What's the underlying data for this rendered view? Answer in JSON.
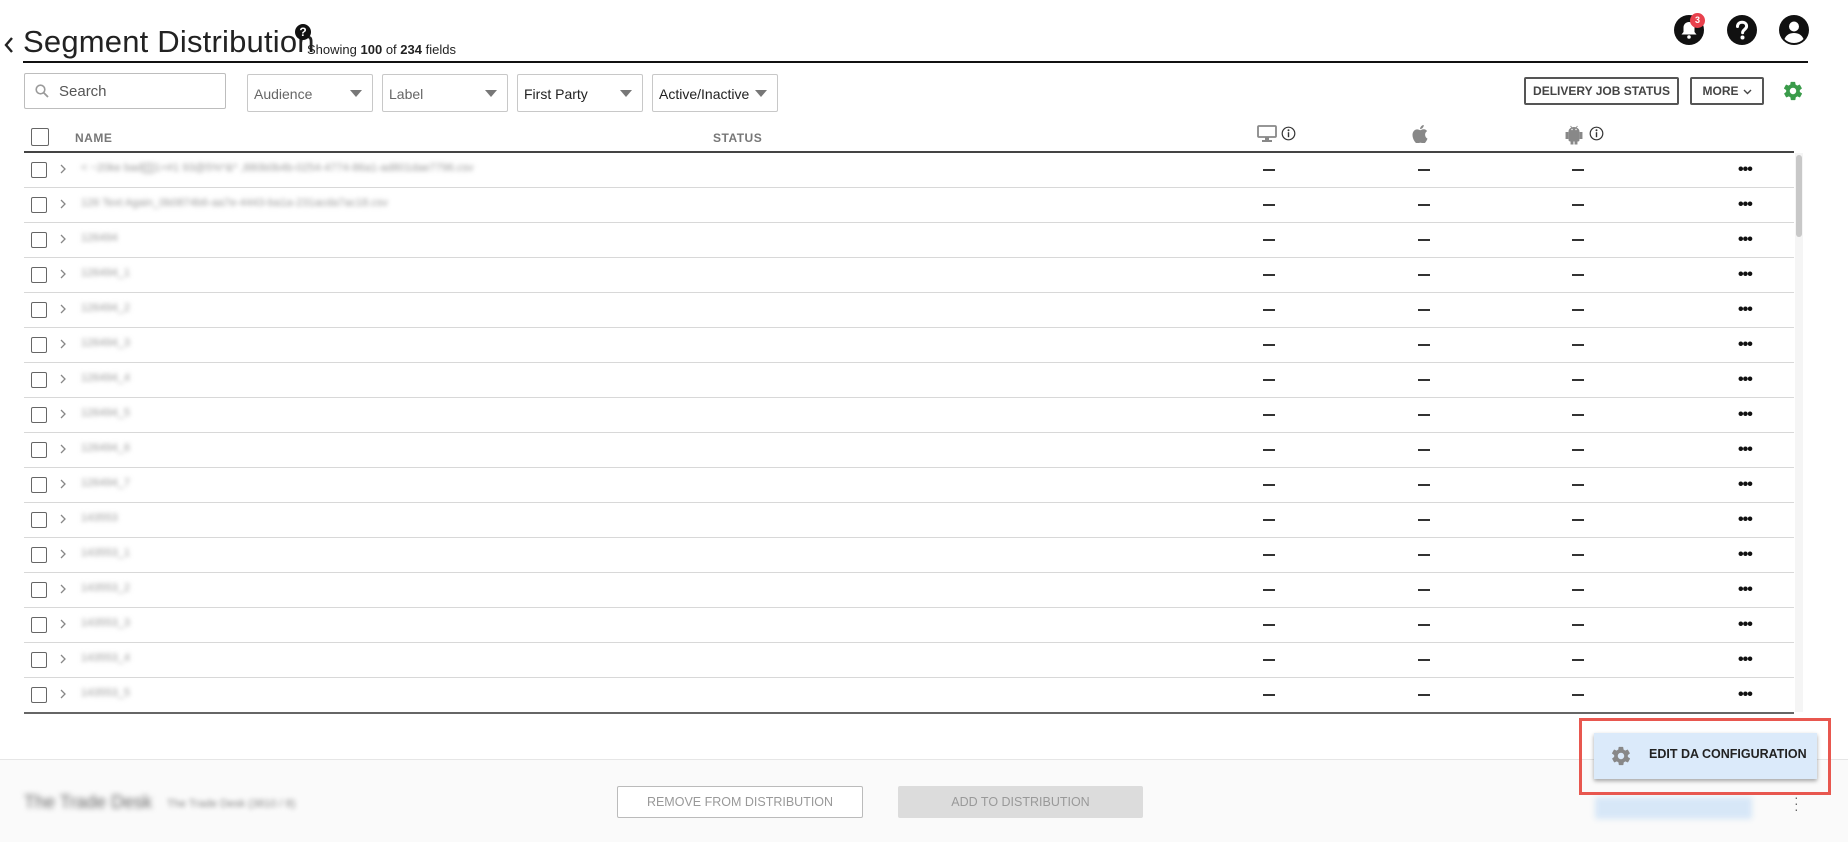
{
  "header": {
    "title": "Segment Distribution",
    "showing_prefix": "Showing",
    "shown_count": "100",
    "of_word": "of",
    "total_count": "234",
    "fields_word": "fields",
    "notification_count": "3"
  },
  "toolbar": {
    "search_placeholder": "Search",
    "filters": {
      "audience": "Audience",
      "label": "Label",
      "first_party": "First Party",
      "active_inactive": "Active/Inactive"
    },
    "delivery_button": "DELIVERY JOB STATUS",
    "more_button": "MORE"
  },
  "table": {
    "columns": {
      "name": "NAME",
      "status": "STATUS"
    },
    "platform_columns": [
      "desktop-icon",
      "apple-icon",
      "android-icon"
    ],
    "rows": [
      {
        "name": "< ~20ke bad[[]]1+#1 93@5%*&* ,880b0b4b-0254-4774-86a1-ad801dae7796.csv",
        "desktop": "—",
        "apple": "—",
        "android": "—"
      },
      {
        "name": "126 Text Again_0b0874b6-aa7e-4443-ba1a-231acda7ac18.csv",
        "desktop": "—",
        "apple": "—",
        "android": "—"
      },
      {
        "name": "126494",
        "desktop": "—",
        "apple": "—",
        "android": "—"
      },
      {
        "name": "126494_1",
        "desktop": "—",
        "apple": "—",
        "android": "—"
      },
      {
        "name": "126494_2",
        "desktop": "—",
        "apple": "—",
        "android": "—"
      },
      {
        "name": "126494_3",
        "desktop": "—",
        "apple": "—",
        "android": "—"
      },
      {
        "name": "126494_4",
        "desktop": "—",
        "apple": "—",
        "android": "—"
      },
      {
        "name": "126494_5",
        "desktop": "—",
        "apple": "—",
        "android": "—"
      },
      {
        "name": "126494_6",
        "desktop": "—",
        "apple": "—",
        "android": "—"
      },
      {
        "name": "126494_7",
        "desktop": "—",
        "apple": "—",
        "android": "—"
      },
      {
        "name": "143553",
        "desktop": "—",
        "apple": "—",
        "android": "—"
      },
      {
        "name": "143553_1",
        "desktop": "—",
        "apple": "—",
        "android": "—"
      },
      {
        "name": "143553_2",
        "desktop": "—",
        "apple": "—",
        "android": "—"
      },
      {
        "name": "143553_3",
        "desktop": "—",
        "apple": "—",
        "android": "—"
      },
      {
        "name": "143553_4",
        "desktop": "—",
        "apple": "—",
        "android": "—"
      },
      {
        "name": "143553_5",
        "desktop": "—",
        "apple": "—",
        "android": "—"
      }
    ]
  },
  "footer": {
    "partner_name": "The Trade Desk",
    "partner_sub": "The Trade Desk (3810 / 8)",
    "remove_button": "REMOVE FROM DISTRIBUTION",
    "add_button": "ADD TO DISTRIBUTION"
  },
  "popup": {
    "edit_label": "EDIT DA CONFIGURATION"
  },
  "colors": {
    "accent_green": "#3a9b4a",
    "notification_red": "#e8414d",
    "highlight_red": "#e8574f",
    "popup_bg": "#dbeafa"
  }
}
